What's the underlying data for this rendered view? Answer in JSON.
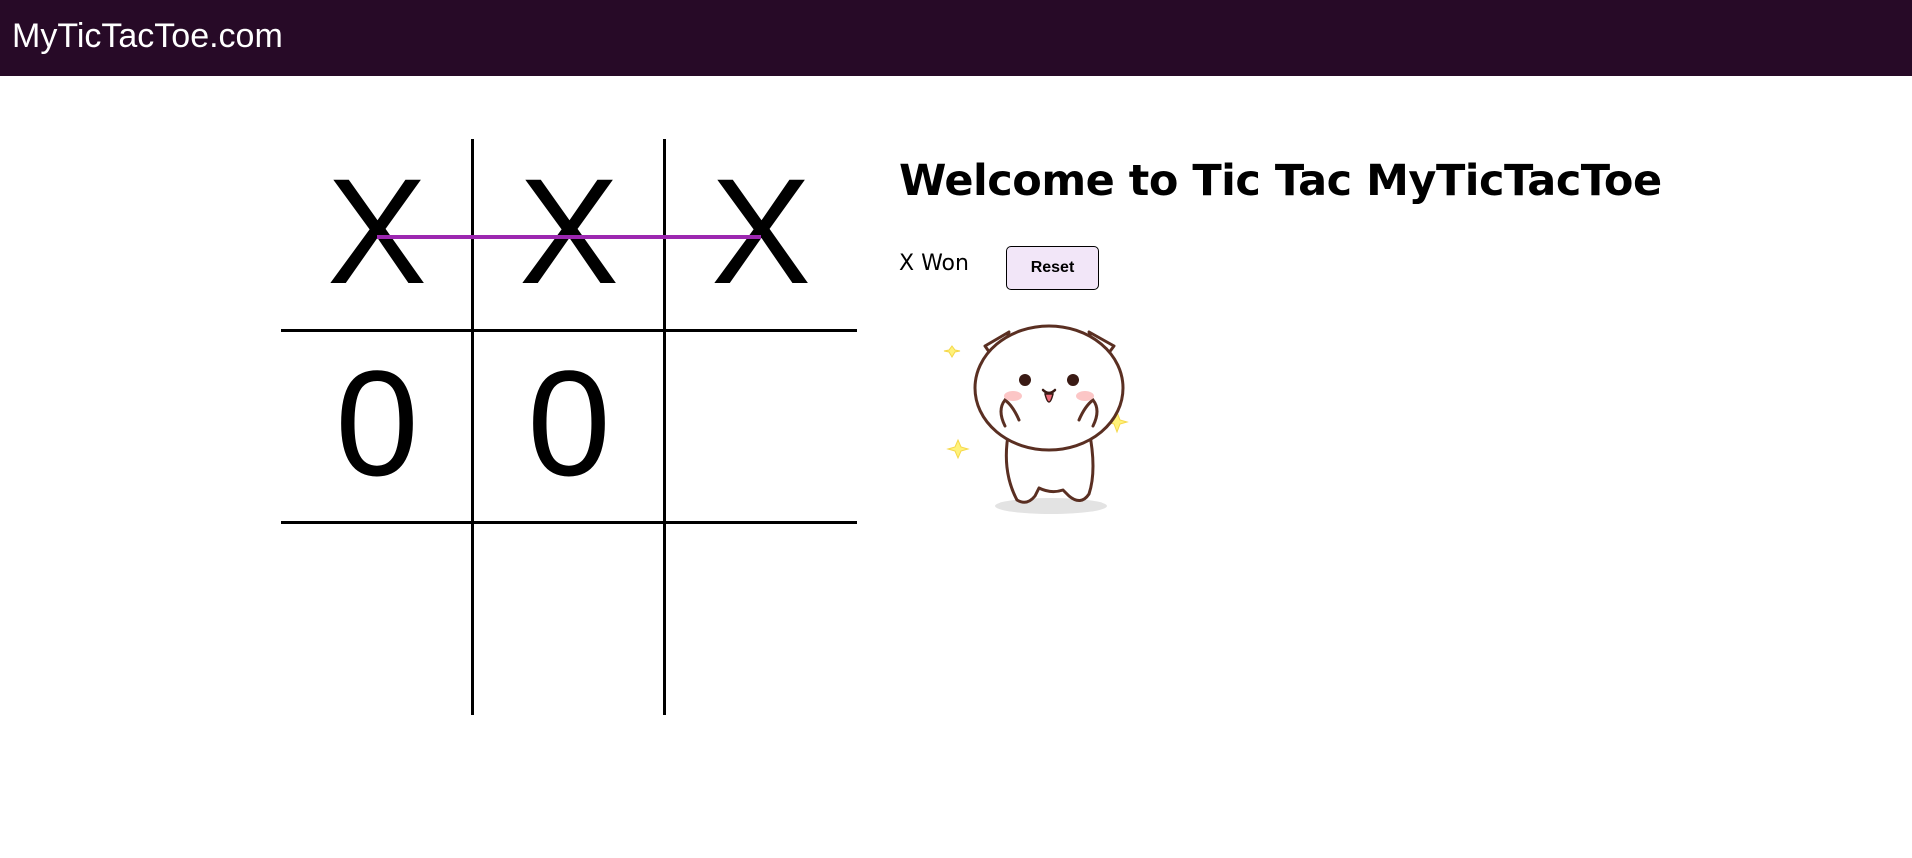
{
  "navbar": {
    "brand": "MyTicTacToe.com",
    "background": "#270a27"
  },
  "board": {
    "cells": [
      "X",
      "X",
      "X",
      "0",
      "0",
      "",
      "",
      "",
      ""
    ],
    "winning_line_color": "#9c27b0",
    "winning_cells": [
      0,
      1,
      2
    ]
  },
  "info": {
    "title": "Welcome to Tic Tac MyTicTacToe",
    "status": "X Won",
    "reset_label": "Reset",
    "reset_bg": "#f2e6f8"
  },
  "illustration": {
    "icon": "happy-cat-icon"
  }
}
